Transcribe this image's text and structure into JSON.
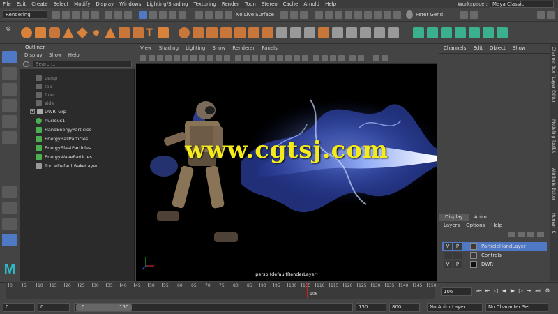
{
  "menubar": {
    "items": [
      "File",
      "Edit",
      "Create",
      "Select",
      "Modify",
      "Display",
      "Windows",
      "Lighting/Shading",
      "Texturing",
      "Render",
      "Toon",
      "Stereo",
      "Cache",
      "Arnold",
      "Help"
    ],
    "workspace_label": "Workspace :",
    "workspace_value": "Maya Classic"
  },
  "statusline": {
    "menuset": "Rendering",
    "live_surface": "No Live Surface",
    "user": "Peter Gend"
  },
  "outliner": {
    "title": "Outliner",
    "menu": [
      "Display",
      "Show",
      "Help"
    ],
    "search_placeholder": "Search...",
    "items": [
      "persp",
      "top",
      "front",
      "side",
      "DWR_Grp",
      "nucleus1",
      "HandEnergyParticles",
      "EnergyBallParticles",
      "EnergyBlastParticles",
      "EnergyWaveParticles",
      "TurtleDefaultBakeLayer"
    ]
  },
  "viewport": {
    "menu": [
      "View",
      "Shading",
      "Lighting",
      "Show",
      "Renderer",
      "Panels"
    ],
    "camera_label": "persp (defaultRenderLayer)",
    "watermark": "www.cgtsj.com"
  },
  "channelbox": {
    "menu": [
      "Channels",
      "Edit",
      "Object",
      "Show"
    ],
    "layer_tabs": [
      "Display",
      "Anim"
    ],
    "layer_menu": [
      "Layers",
      "Options",
      "Help"
    ],
    "layers": [
      {
        "v": "V",
        "p": "P",
        "name": "ParticleHandLayer",
        "selected": true
      },
      {
        "v": "",
        "p": "",
        "name": "Controls",
        "selected": false
      },
      {
        "v": "V",
        "p": "P",
        "name": "DWR",
        "selected": false
      }
    ]
  },
  "side_tabs": [
    "Channel Box / Layer Editor",
    "Modeling Toolkit",
    "Attribute Editor",
    "Human IK"
  ],
  "timeslider": {
    "ticks": [
      "0",
      "5",
      "10",
      "15",
      "20",
      "25",
      "30",
      "35",
      "40",
      "45",
      "50",
      "55",
      "60",
      "65",
      "70",
      "75",
      "80",
      "85",
      "90",
      "95",
      "100",
      "105",
      "110",
      "115",
      "120",
      "125",
      "130",
      "135",
      "140",
      "145",
      "150"
    ],
    "current_frame_marker": "106",
    "current_frame_field": "106"
  },
  "rangebar": {
    "start_field": "0",
    "start_field2": "0",
    "range_start": "0",
    "range_end": "150",
    "end_field": "150",
    "end_field2": "800",
    "anim_layer": "No Anim Layer",
    "character_set": "No Character Set"
  },
  "colors": {
    "accent_blue": "#4f79c4",
    "watermark": "#f5ea1c",
    "shelf_orange": "#d9823b",
    "shelf_teal": "#3bb08f"
  }
}
